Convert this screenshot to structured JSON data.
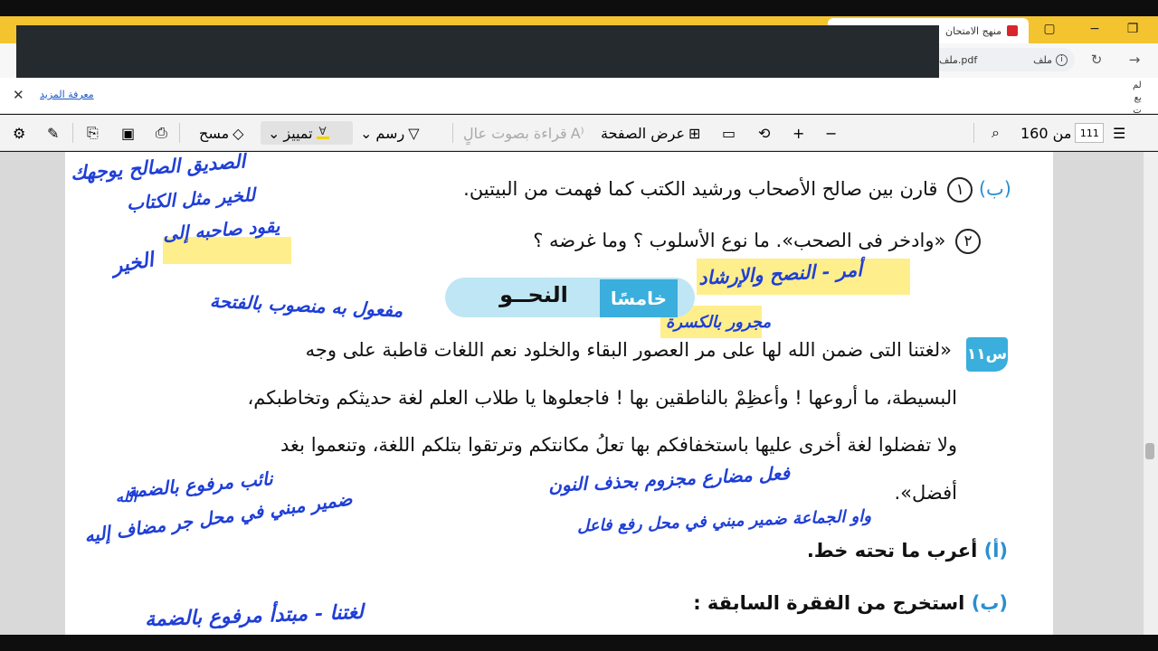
{
  "browser": {
    "tab_title": "منهج الامتحان",
    "tab_close": "x",
    "address_file": "ملف.pdf",
    "address_label": "ملف",
    "notif_link": "معرفة المزيد",
    "side_text_1": "لم",
    "side_text_2": "يع",
    "side_text_3": "ت"
  },
  "pdf_toolbar": {
    "page_current": "111",
    "page_total": "من 160",
    "page_view": "عرض الصفحة",
    "read_aloud": "قراءة بصوت عالٍ",
    "draw": "رسم",
    "highlight": "تمييز",
    "erase": "مسح"
  },
  "document": {
    "top_q": {
      "mark": "(ب)",
      "num": "١",
      "text": "قارن بين صالح الأصحاب ورشيد الكتب كما فهمت من البيتين."
    },
    "q2": {
      "num": "٢",
      "text": "«وادخر فى الصحب». ما نوع الأسلوب ؟ وما غرضه ؟"
    },
    "section": {
      "tag": "خامسًا",
      "title": "النحــو"
    },
    "q11": {
      "badge": "س١١",
      "line1": "«لغتنا التى ضمن الله لها على مر العصور البقاء والخلود نعم اللغات قاطبة على وجه",
      "line2": "البسيطة، ما أروعها ! وأعظِمْ بالناطقين بها ! فاجعلوها يا طلاب العلم لغة حديثكم وتخاطبكم،",
      "line3": "ولا تفضلوا لغة أخرى عليها باستخفافكم بها تعلُ مكانتكم وترتقوا بتلكم اللغة، وتنعموا بغد",
      "line4": "أفضل»."
    },
    "sub_a": {
      "mark": "(أ)",
      "text": "أعرب ما تحته خط."
    },
    "sub_b": {
      "mark": "(ب)",
      "text": "استخرج من الفقرة السابقة :"
    }
  },
  "annotations": {
    "a1": "الصديق الصالح يوجهك",
    "a2": "للخير مثل الكتاب",
    "a3": "يقود صاحبه إلى",
    "a4": "الخير",
    "a5": "أمر - النصح والإرشاد",
    "a6": "مفعول به منصوب بالفتحة",
    "a7": "مجرور بالكسرة",
    "a8": "فعل مضارع مجزوم بحذف النون",
    "a9": "نائب مرفوع بالضمة",
    "a10": "الله",
    "a11": "ضمير مبني في محل جر مضاف إليه",
    "a12": "واو الجماعة ضمير مبني في محل رفع فاعل",
    "a13": "لغتنا - مبتدأ مرفوع بالضمة"
  }
}
